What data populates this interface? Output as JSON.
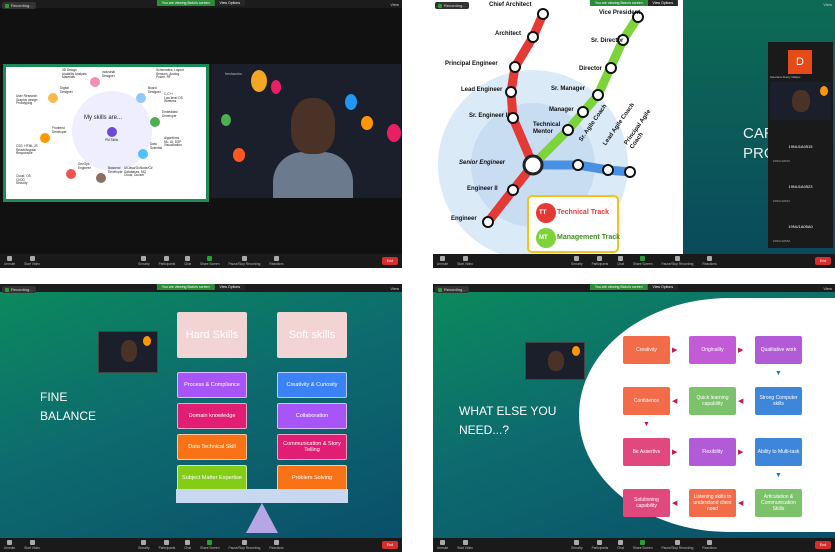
{
  "meeting": {
    "recording": "Recording...",
    "sharing": "You are viewing Babu's screen",
    "view_options": "View Options",
    "view": "View"
  },
  "toolbar": {
    "unmute": "Unmute",
    "start_video": "Start Video",
    "security": "Security",
    "participants": "Participants",
    "participants_count": "40",
    "chat": "Chat",
    "share_screen": "Share Screen",
    "pause_recording": "Pause/Stop Recording",
    "reactions": "Reactions",
    "end": "End"
  },
  "win1": {
    "center": "My skills are...",
    "center_name": "PM Skills",
    "cam_label": "freshworks",
    "nodes": [
      "3D Design\nUsability Analysis\nMaterials",
      "Industrial\nDesigner",
      "Schematics, Layout\nSensors, Analog\nPower, RF",
      "Digital\nDesigner",
      "Board\nDesigner",
      "C,C++\nLow level OS\nWireless",
      "User Research\nGraphic design\nPrototyping",
      "Embedded\nDeveloper",
      "Frontend\nDeveloper",
      "Algorithms\nML, AI, DSP\nVisualization",
      "CSS, HTML,JS\nReact/Angular\nResponsive",
      "Data\nScientist",
      "DevOps\nEngineer",
      "Backend\nDeveloper",
      "UI/Java/GoNode/C#\nDatabases, MQ\nCloud, Docker",
      "Cloud, OS\nCI/CD\nSecurity"
    ]
  },
  "win2": {
    "stations": [
      "Chief Architect",
      "Vice President",
      "Architect",
      "Sr. Director",
      "Principal Engineer",
      "Director",
      "Lead Engineer",
      "Sr. Manager",
      "Sr. Engineer II",
      "Manager",
      "Technical Mentor",
      "Senior Engineer",
      "Sr. Agile Coach",
      "Lead Agile Coach",
      "Principal Agile Coach",
      "Engineer II",
      "Engineer"
    ],
    "tt_badge": "TT",
    "tt_label": "Technical Track",
    "mt_badge": "MT",
    "mt_label": "Management Track",
    "slide_text": "CAR\nPROGRESS",
    "avatar_initial": "D",
    "self_name": "Sreeramu Dunty Vellapu",
    "tiles": [
      {
        "id": "19NU1A0515",
        "sub": "19NU1A0515"
      },
      {
        "id": "19NU1A0523",
        "sub": "19NU1A0523"
      },
      {
        "id": "19NU1A05A0",
        "sub": "19NU1A05A0"
      }
    ]
  },
  "win3": {
    "title": "FINE\nBALANCE",
    "hard": "Hard Skills",
    "soft": "Soft skills",
    "hard_items": [
      "Process & Compliance",
      "Domain knowledge",
      "Data Technical Skill",
      "Subject Matter Expertise"
    ],
    "soft_items": [
      "Creativity & Curiosity",
      "Collaboration",
      "Communication & Story Telling",
      "Problem Solving"
    ],
    "colors": {
      "hard": [
        "#a855f7",
        "#e11d74",
        "#f97316",
        "#84cc16"
      ],
      "soft": [
        "#3b82f6",
        "#a855f7",
        "#e11d74",
        "#f97316"
      ]
    }
  },
  "win4": {
    "title": "WHAT ELSE YOU\nNEED...?",
    "row1": [
      "Creativity",
      "Originality",
      "Qualitative work"
    ],
    "row2": [
      "Confidence",
      "Quick learning capability",
      "Strong Computer skills"
    ],
    "row3": [
      "Be Assertive",
      "Flexibility",
      "Ability to Multi-task"
    ],
    "row4": [
      "Solutioning capability",
      "Listening skills to understand client need",
      "Articulation & Communication Skills"
    ],
    "colors": {
      "row1": [
        "#f36c4a",
        "#c45bd6",
        "#b15bd6"
      ],
      "row2": [
        "#f36c4a",
        "#7cc26a",
        "#3d86d9"
      ],
      "row3": [
        "#e0487e",
        "#b15bd6",
        "#3d86d9"
      ],
      "row4": [
        "#e0487e",
        "#f36c4a",
        "#7cc26a"
      ]
    }
  }
}
